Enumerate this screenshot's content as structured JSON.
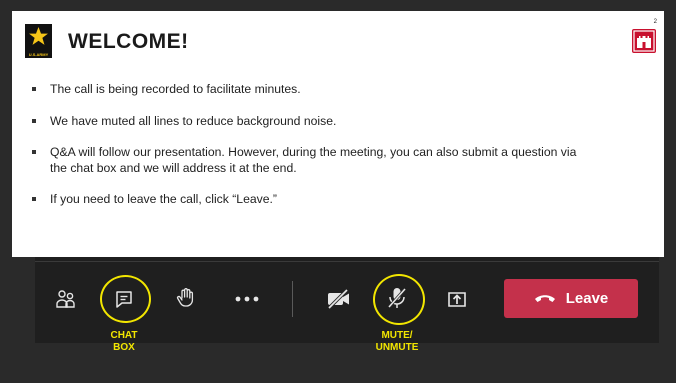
{
  "slide": {
    "title": "WELCOME!",
    "page_number": "2",
    "army_logo_text": "U.S.ARMY",
    "bullets": [
      "The call is being recorded to facilitate minutes.",
      "We have muted all lines to reduce background noise.",
      "Q&A will follow our presentation. However, during the meeting, you can also submit a question via the chat box and we will address it at the end.",
      "If you need to leave the call, click “Leave.”"
    ]
  },
  "toolbar": {
    "buttons": [
      {
        "name": "participants",
        "icon": "people-icon"
      },
      {
        "name": "chat",
        "icon": "chat-icon"
      },
      {
        "name": "raise-hand",
        "icon": "hand-icon"
      },
      {
        "name": "more",
        "icon": "more-icon"
      },
      {
        "name": "camera",
        "icon": "camera-off-icon"
      },
      {
        "name": "mic",
        "icon": "mic-off-icon"
      },
      {
        "name": "share",
        "icon": "share-icon"
      }
    ],
    "leave_label": "Leave"
  },
  "annotations": {
    "chat_line1": "CHAT",
    "chat_line2": "BOX",
    "mute_line1": "MUTE/",
    "mute_line2": "UNMUTE",
    "color": "#f2e600"
  },
  "colors": {
    "leave": "#c4314b",
    "usace": "#c8102e"
  }
}
